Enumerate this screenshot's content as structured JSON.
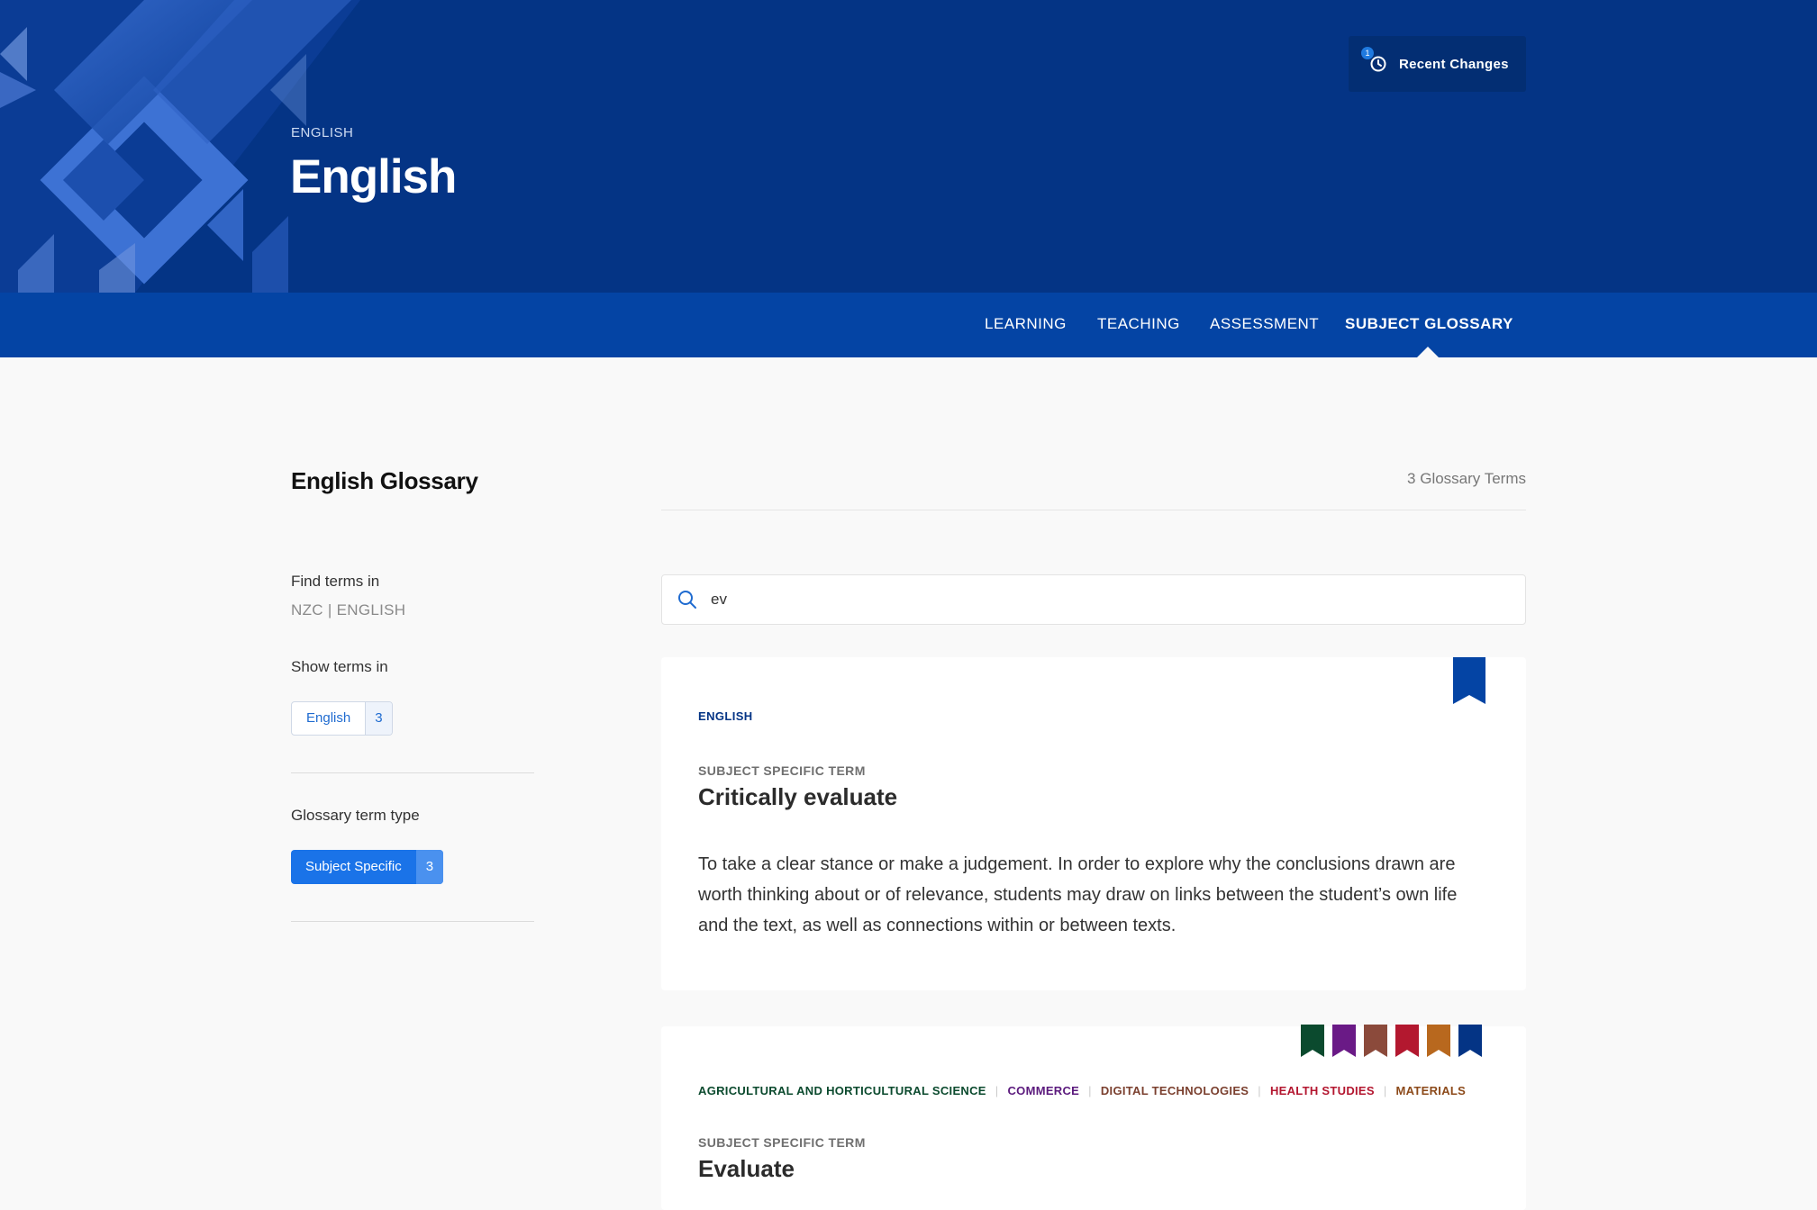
{
  "header": {
    "breadcrumb": "ENGLISH",
    "title": "English",
    "recent_changes": {
      "label": "Recent Changes",
      "badge": "1"
    }
  },
  "nav": {
    "items": [
      {
        "label": "LEARNING"
      },
      {
        "label": "TEACHING"
      },
      {
        "label": "ASSESSMENT"
      },
      {
        "label": "SUBJECT GLOSSARY"
      }
    ],
    "active": "SUBJECT GLOSSARY"
  },
  "sidebar": {
    "title": "English Glossary",
    "find_label": "Find terms in",
    "find_value": "NZC | ENGLISH",
    "show_label": "Show terms in",
    "show_chip": {
      "label": "English",
      "count": "3"
    },
    "type_label": "Glossary term type",
    "type_chip": {
      "label": "Subject Specific",
      "count": "3"
    }
  },
  "main": {
    "term_count": "3 Glossary Terms",
    "search": {
      "value": "ev",
      "icon": "search-icon"
    },
    "cards": [
      {
        "tag": "ENGLISH",
        "tag_color": "#043485",
        "ribbon_colors": [
          "#0444a4"
        ],
        "type": "SUBJECT SPECIFIC TERM",
        "term": "Critically evaluate",
        "definition": "To take a clear stance or make a judgement. In order to explore why the conclusions drawn are worth thinking about or of relevance, students may draw on links between the student’s own life and the text, as well as connections within or between texts."
      },
      {
        "tags": [
          {
            "label": "AGRICULTURAL AND HORTICULTURAL SCIENCE",
            "color": "#0b4a2e"
          },
          {
            "label": "COMMERCE",
            "color": "#5b1a7d"
          },
          {
            "label": "DIGITAL TECHNOLOGIES",
            "color": "#7a3f2e"
          },
          {
            "label": "HEALTH STUDIES",
            "color": "#b3162f"
          },
          {
            "label": "MATERIALS",
            "color": "#8c4a1a"
          }
        ],
        "ribbon_colors": [
          "#0b4a2e",
          "#6a1a86",
          "#8b4a3b",
          "#b3182f",
          "#b8681e",
          "#043485"
        ],
        "type": "SUBJECT SPECIFIC TERM",
        "term": "Evaluate"
      }
    ]
  }
}
